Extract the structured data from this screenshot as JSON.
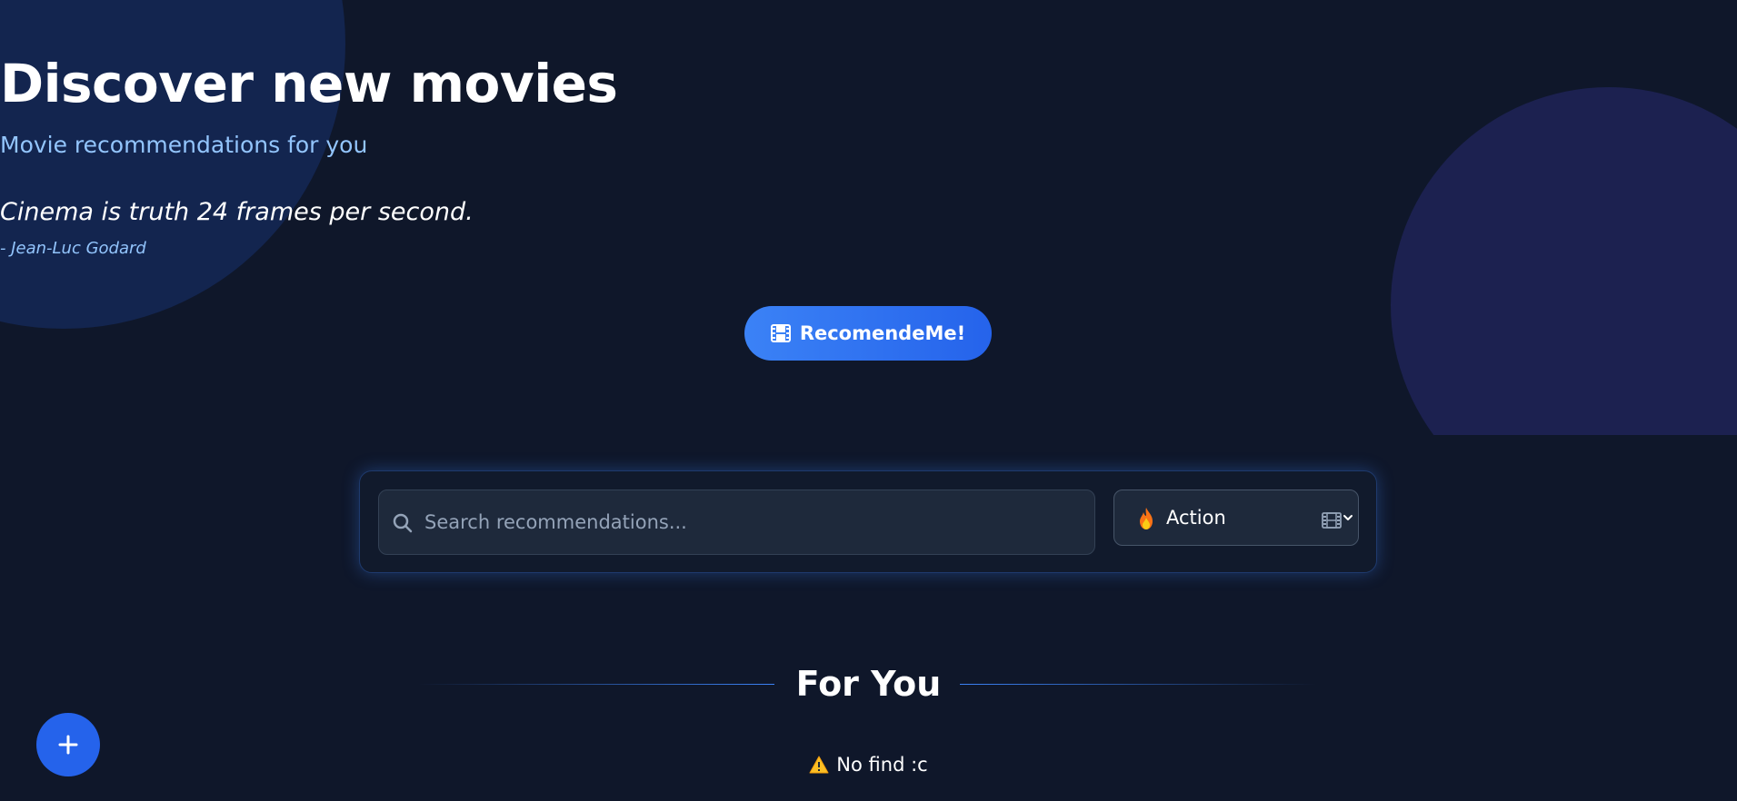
{
  "hero": {
    "title": "Discover new movies",
    "subtitle": "Movie recommendations for you",
    "quote": "Cinema is truth 24 frames per second.",
    "author": "- Jean-Luc Godard",
    "cta_label": "RecomendeMe!",
    "cta_icon": "film-icon"
  },
  "search": {
    "placeholder": "Search recommendations...",
    "value": "",
    "icon": "search-icon"
  },
  "genre": {
    "selected": "Action",
    "selected_icon": "fire-emoji",
    "options": [
      "Action"
    ]
  },
  "section": {
    "title": "For You",
    "empty_text": "No find :c",
    "empty_icon": "warning-icon"
  },
  "fab": {
    "icon": "plus-icon"
  },
  "colors": {
    "background": "#0f172a",
    "accent": "#2563eb",
    "accent_light": "#3b82f6",
    "subtitle": "#93c5fd",
    "panel": "#1e293b"
  }
}
